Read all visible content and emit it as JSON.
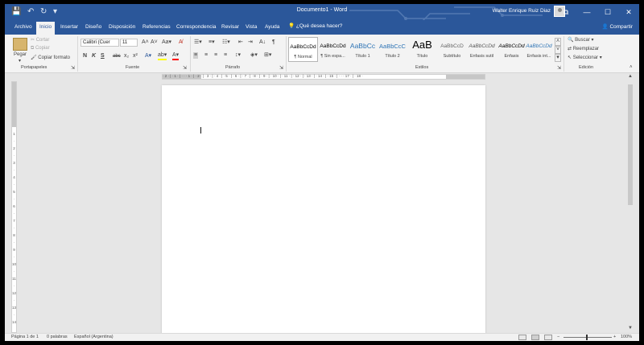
{
  "titlebar": {
    "document_title": "Documento1 - Word",
    "user_name": "Walter Enrique Ruiz Diaz",
    "quick_access": {
      "save": "💾",
      "undo": "↶",
      "redo": "↻",
      "customize": "▾"
    },
    "window_controls": {
      "ribbon_options": "⧉",
      "minimize": "—",
      "maximize": "☐",
      "close": "✕"
    }
  },
  "tabs": [
    "Archivo",
    "Inicio",
    "Insertar",
    "Diseño",
    "Disposición",
    "Referencias",
    "Correspondencia",
    "Revisar",
    "Vista",
    "Ayuda"
  ],
  "active_tab": "Inicio",
  "tell_me": "¿Qué desea hacer?",
  "share": "Compartir",
  "ribbon": {
    "clipboard": {
      "paste": "Pegar",
      "cut": "Cortar",
      "copy": "Copiar",
      "format_painter": "Copiar formato",
      "group_label": "Portapapeles"
    },
    "font": {
      "font_name": "Calibri (Cuer",
      "font_size": "11",
      "bold": "N",
      "italic": "K",
      "underline": "S",
      "strikethrough": "abc",
      "subscript": "x₂",
      "superscript": "x²",
      "group_label": "Fuente"
    },
    "paragraph": {
      "group_label": "Párrafo"
    },
    "styles": {
      "items": [
        {
          "sample": "AaBbCcDd",
          "name": "¶ Normal"
        },
        {
          "sample": "AaBbCcDd",
          "name": "¶ Sin espa..."
        },
        {
          "sample": "AaBbCc",
          "name": "Título 1"
        },
        {
          "sample": "AaBbCcC",
          "name": "Título 2"
        },
        {
          "sample": "AaB",
          "name": "Título"
        },
        {
          "sample": "AaBbCcD",
          "name": "Subtítulo"
        },
        {
          "sample": "AaBbCcDd",
          "name": "Énfasis sutil"
        },
        {
          "sample": "AaBbCcDd",
          "name": "Énfasis"
        },
        {
          "sample": "AaBbCcDd",
          "name": "Énfasis int..."
        }
      ],
      "group_label": "Estilos"
    },
    "editing": {
      "find": "Buscar",
      "replace": "Reemplazar",
      "select": "Seleccionar",
      "group_label": "Edición"
    }
  },
  "ruler": {
    "horizontal": "· 2 · | · 1 · | · · · 1 · | · 2 · | · 3 · | · 4 · | · 5 · | · 6 · | · 7 · | · 8 · | · 9 · | · 10 · | · 11 · | · 12 · | · 13 · | · 14 · | · 15 · | · · · 17 · | · 18 ·",
    "vertical": [
      "1",
      "",
      "2",
      "",
      "3",
      "",
      "4",
      "",
      "5",
      "",
      "6",
      "",
      "7",
      "",
      "8",
      "",
      "9",
      "",
      "10",
      "",
      "11",
      "",
      "12",
      "",
      "13",
      "",
      "14",
      "",
      "15",
      "",
      "16"
    ]
  },
  "status": {
    "page": "Página 1 de 1",
    "words": "0 palabras",
    "language": "Español (Argentina)",
    "zoom": "100%",
    "zoom_level": 1.0
  },
  "colors": {
    "accent": "#2b579a",
    "highlight": "#ffff00",
    "font_color": "#ff0000"
  }
}
